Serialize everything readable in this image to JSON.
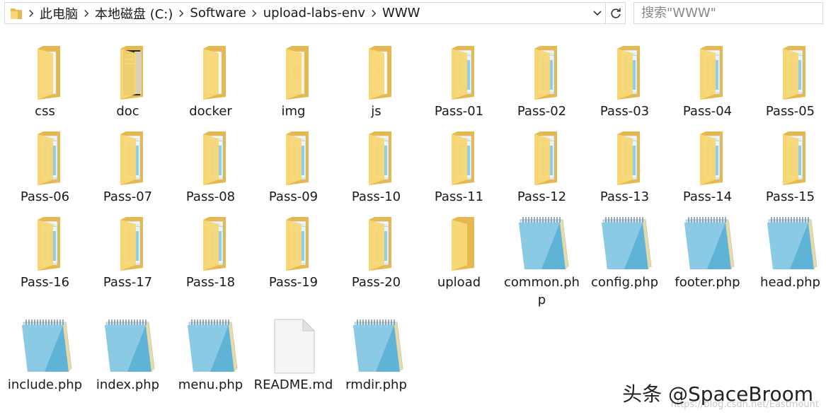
{
  "address_bar": {
    "crumbs": [
      "此电脑",
      "本地磁盘 (C:)",
      "Software",
      "upload-labs-env",
      "WWW"
    ]
  },
  "search": {
    "placeholder": "搜索\"WWW\""
  },
  "items": [
    {
      "label": "css",
      "type": "folder-doc"
    },
    {
      "label": "doc",
      "type": "folder-dark"
    },
    {
      "label": "docker",
      "type": "folder-doc"
    },
    {
      "label": "img",
      "type": "folder-img"
    },
    {
      "label": "js",
      "type": "folder-js"
    },
    {
      "label": "Pass-01",
      "type": "folder-notepad"
    },
    {
      "label": "Pass-02",
      "type": "folder-notepad"
    },
    {
      "label": "Pass-03",
      "type": "folder-notepad"
    },
    {
      "label": "Pass-04",
      "type": "folder-notepad"
    },
    {
      "label": "Pass-05",
      "type": "folder-notepad"
    },
    {
      "label": "Pass-06",
      "type": "folder-notepad"
    },
    {
      "label": "Pass-07",
      "type": "folder-notepad"
    },
    {
      "label": "Pass-08",
      "type": "folder-notepad"
    },
    {
      "label": "Pass-09",
      "type": "folder-notepad"
    },
    {
      "label": "Pass-10",
      "type": "folder-notepad"
    },
    {
      "label": "Pass-11",
      "type": "folder-notepad"
    },
    {
      "label": "Pass-12",
      "type": "folder-notepad"
    },
    {
      "label": "Pass-13",
      "type": "folder-notepad"
    },
    {
      "label": "Pass-14",
      "type": "folder-notepad"
    },
    {
      "label": "Pass-15",
      "type": "folder-notepad"
    },
    {
      "label": "Pass-16",
      "type": "folder-notepad"
    },
    {
      "label": "Pass-17",
      "type": "folder-notepad"
    },
    {
      "label": "Pass-18",
      "type": "folder-notepad"
    },
    {
      "label": "Pass-19",
      "type": "folder-notepad"
    },
    {
      "label": "Pass-20",
      "type": "folder-notepad"
    },
    {
      "label": "upload",
      "type": "folder-empty"
    },
    {
      "label": "common.php",
      "type": "notepad"
    },
    {
      "label": "config.php",
      "type": "notepad"
    },
    {
      "label": "footer.php",
      "type": "notepad"
    },
    {
      "label": "head.php",
      "type": "notepad"
    },
    {
      "label": "include.php",
      "type": "notepad"
    },
    {
      "label": "index.php",
      "type": "notepad"
    },
    {
      "label": "menu.php",
      "type": "notepad"
    },
    {
      "label": "README.md",
      "type": "blank-file"
    },
    {
      "label": "rmdir.php",
      "type": "notepad"
    }
  ],
  "watermark": "头条 @SpaceBroom",
  "watermark_url": "https://blog.csdn.net/Eastmount",
  "colors": {
    "folder_back": "#e6b94e",
    "folder_front": "#f8d775",
    "notepad_blue": "#5fb3d6",
    "accent": "#0078d7"
  }
}
